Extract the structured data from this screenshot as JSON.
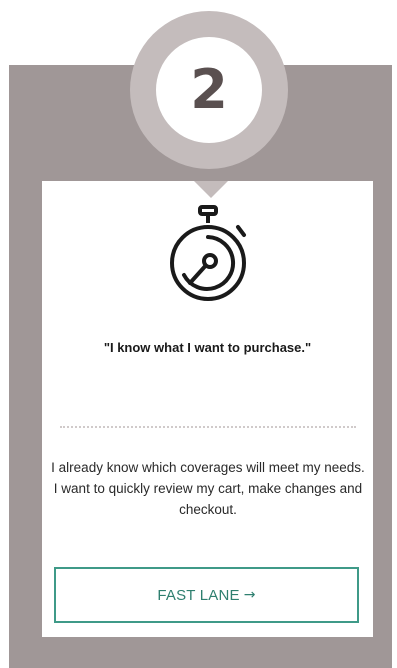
{
  "step": {
    "number": "2"
  },
  "icon": "stopwatch-icon",
  "card": {
    "headline": "\"I know what I want to purchase.\"",
    "description": "I already know which coverages will meet my needs. I want to quickly review my cart, make changes and checkout."
  },
  "cta": {
    "label": "FAST LANE",
    "arrow": "→"
  },
  "colors": {
    "frame": "#a09797",
    "badge_ring": "#c4bcbc",
    "badge_text": "#5a5050",
    "button_border": "#3f9a88",
    "button_text": "#2e7f6f"
  }
}
